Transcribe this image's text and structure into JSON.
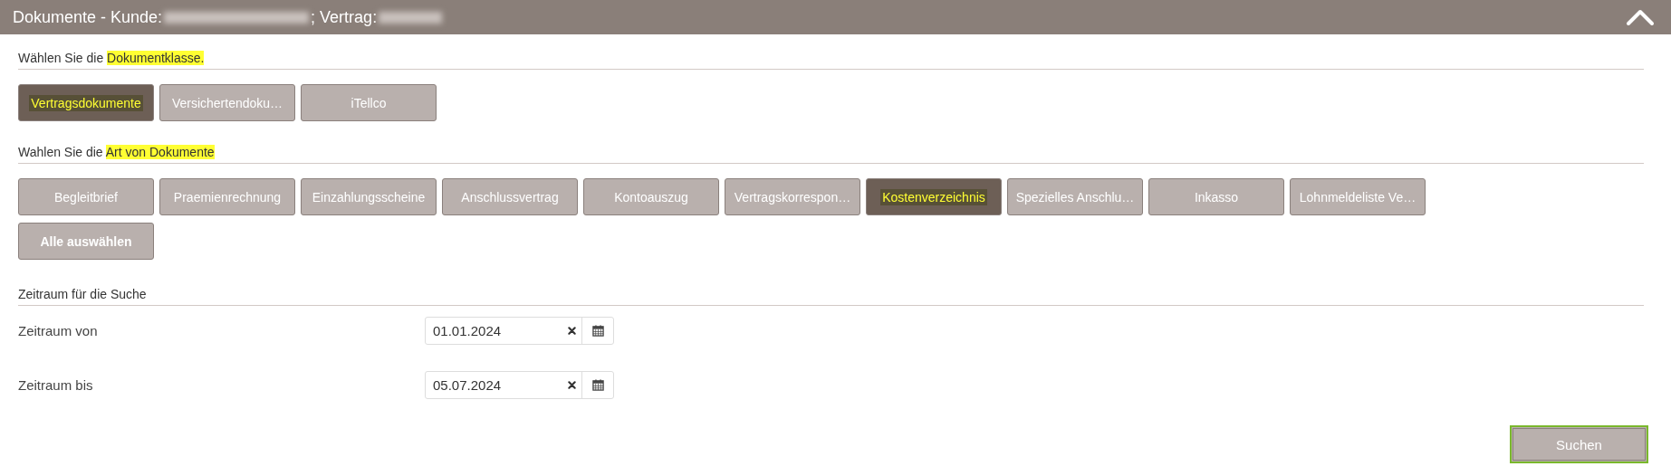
{
  "panel": {
    "title_parts": [
      {
        "kind": "text",
        "text": "Dokumente - Kunde:"
      },
      {
        "kind": "redacted"
      },
      {
        "kind": "text",
        "text": "; Vertrag:"
      },
      {
        "kind": "redacted"
      }
    ]
  },
  "document_class": {
    "label_prefix": "Wählen Sie die",
    "label_highlight": "Dokumentklasse.",
    "options": [
      {
        "label": "Vertragsdokumente",
        "selected": true
      },
      {
        "label": "Versichertendoku…",
        "selected": false
      },
      {
        "label": "iTellco",
        "selected": false
      }
    ]
  },
  "document_type": {
    "label_prefix": "Wahlen Sie die",
    "label_highlight": "Art von Dokumente",
    "options": [
      {
        "label": "Begleitbrief",
        "selected": false
      },
      {
        "label": "Praemienrechnung",
        "selected": false
      },
      {
        "label": "Einzahlungsscheine",
        "selected": false
      },
      {
        "label": "Anschlussvertrag",
        "selected": false
      },
      {
        "label": "Kontoauszug",
        "selected": false
      },
      {
        "label": "Vertragskorrespon…",
        "selected": false
      },
      {
        "label": "Kostenverzeichnis",
        "selected": true
      },
      {
        "label": "Spezielles Anschlu…",
        "selected": false
      },
      {
        "label": "Inkasso",
        "selected": false
      },
      {
        "label": "Lohnmeldeliste Ve…",
        "selected": false
      }
    ],
    "select_all": "Alle auswählen"
  },
  "period": {
    "heading": "Zeitraum für die Suche",
    "fields": [
      {
        "label": "Zeitraum von",
        "value": "01.01.2024"
      },
      {
        "label": "Zeitraum bis",
        "value": "05.07.2024"
      }
    ]
  },
  "search_button": "Suchen"
}
